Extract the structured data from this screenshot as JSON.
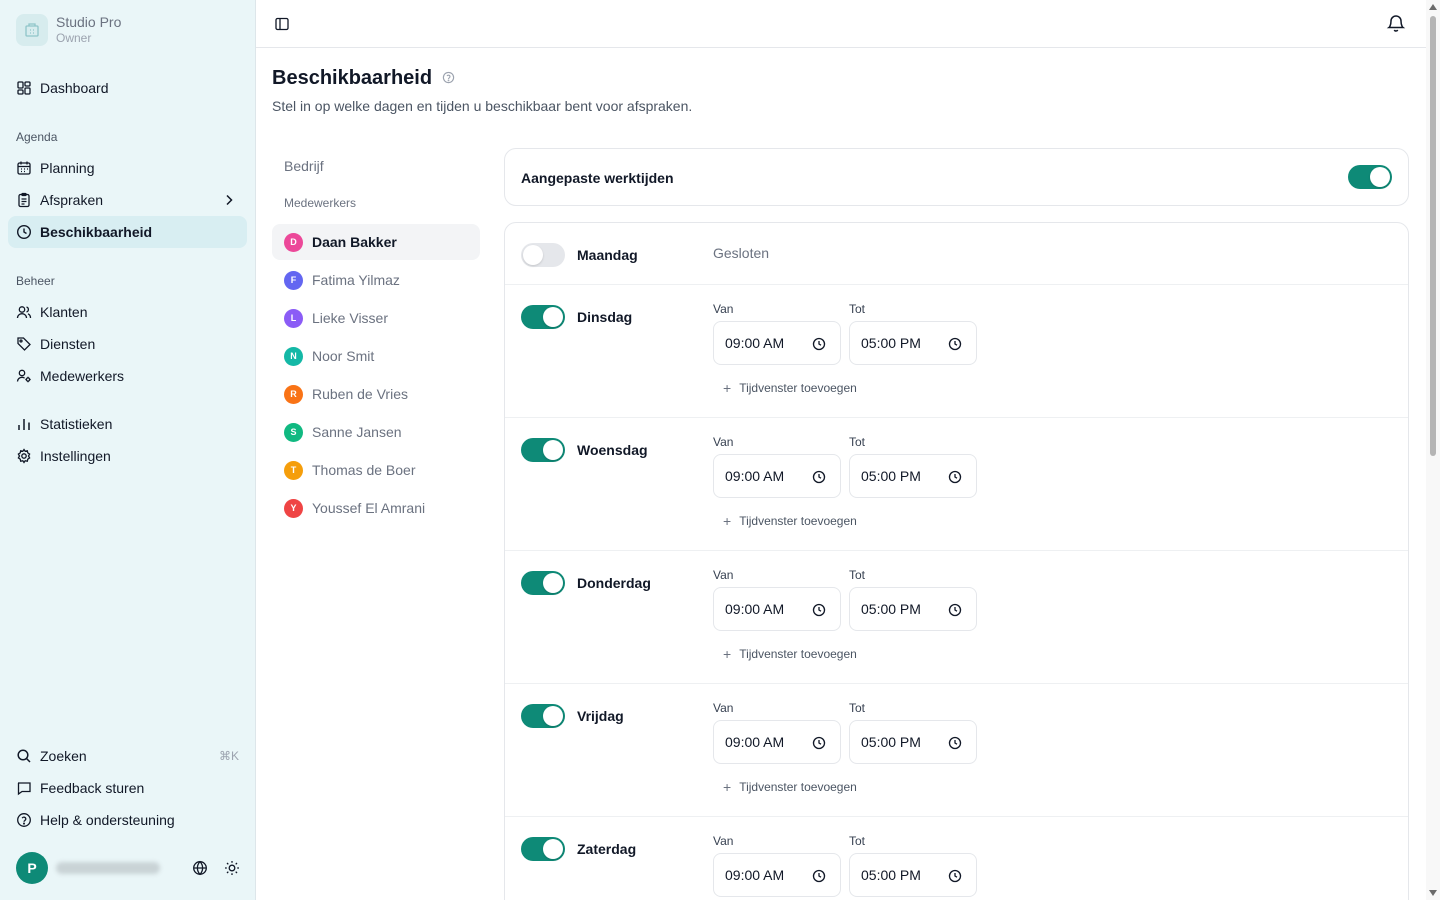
{
  "brand": {
    "name": "Studio Pro",
    "role": "Owner"
  },
  "nav": {
    "dashboard": "Dashboard",
    "group_agenda": "Agenda",
    "planning": "Planning",
    "afspraken": "Afspraken",
    "beschikbaarheid": "Beschikbaarheid",
    "group_beheer": "Beheer",
    "klanten": "Klanten",
    "diensten": "Diensten",
    "medewerkers": "Medewerkers",
    "statistieken": "Statistieken",
    "instellingen": "Instellingen",
    "zoeken": "Zoeken",
    "zoeken_shortcut": "⌘K",
    "feedback": "Feedback sturen",
    "help": "Help & ondersteuning"
  },
  "user": {
    "initial": "P"
  },
  "page": {
    "title": "Beschikbaarheid",
    "subtitle": "Stel in op welke dagen en tijden u beschikbaar bent voor afspraken."
  },
  "staff": {
    "company": "Bedrijf",
    "group": "Medewerkers",
    "items": [
      {
        "initial": "D",
        "name": "Daan Bakker",
        "color": "#ec4899",
        "active": true
      },
      {
        "initial": "F",
        "name": "Fatima Yilmaz",
        "color": "#6366f1"
      },
      {
        "initial": "L",
        "name": "Lieke Visser",
        "color": "#8b5cf6"
      },
      {
        "initial": "N",
        "name": "Noor Smit",
        "color": "#14b8a6"
      },
      {
        "initial": "R",
        "name": "Ruben de Vries",
        "color": "#f97316"
      },
      {
        "initial": "S",
        "name": "Sanne Jansen",
        "color": "#10b981"
      },
      {
        "initial": "T",
        "name": "Thomas de Boer",
        "color": "#f59e0b"
      },
      {
        "initial": "Y",
        "name": "Youssef El Amrani",
        "color": "#ef4444"
      }
    ]
  },
  "custom_hours": {
    "label": "Aangepaste werktijden",
    "enabled": true
  },
  "labels": {
    "from": "Van",
    "to": "Tot",
    "add_window": "Tijdvenster toevoegen",
    "closed": "Gesloten"
  },
  "days": [
    {
      "name": "Maandag",
      "enabled": false
    },
    {
      "name": "Dinsdag",
      "enabled": true,
      "from": "09:00 AM",
      "to": "05:00 PM"
    },
    {
      "name": "Woensdag",
      "enabled": true,
      "from": "09:00 AM",
      "to": "05:00 PM"
    },
    {
      "name": "Donderdag",
      "enabled": true,
      "from": "09:00 AM",
      "to": "05:00 PM"
    },
    {
      "name": "Vrijdag",
      "enabled": true,
      "from": "09:00 AM",
      "to": "05:00 PM"
    },
    {
      "name": "Zaterdag",
      "enabled": true,
      "from": "09:00 AM",
      "to": "05:00 PM"
    }
  ],
  "colors": {
    "accent": "#0e8a77",
    "sidebar_bg": "#eaf6f8"
  },
  "icons": {
    "brand": "building-icon",
    "dashboard": "grid-icon",
    "planning": "calendar-icon",
    "afspraken": "clipboard-icon",
    "beschikbaarheid": "clock-icon",
    "klanten": "users-icon",
    "diensten": "tag-icon",
    "medewerkers": "user-cog-icon",
    "statistieken": "bar-chart-icon",
    "instellingen": "gear-icon",
    "zoeken": "search-icon",
    "feedback": "message-icon",
    "help": "help-circle-icon",
    "topbar_toggle": "sidebar-toggle-icon",
    "notifications": "bell-icon"
  }
}
